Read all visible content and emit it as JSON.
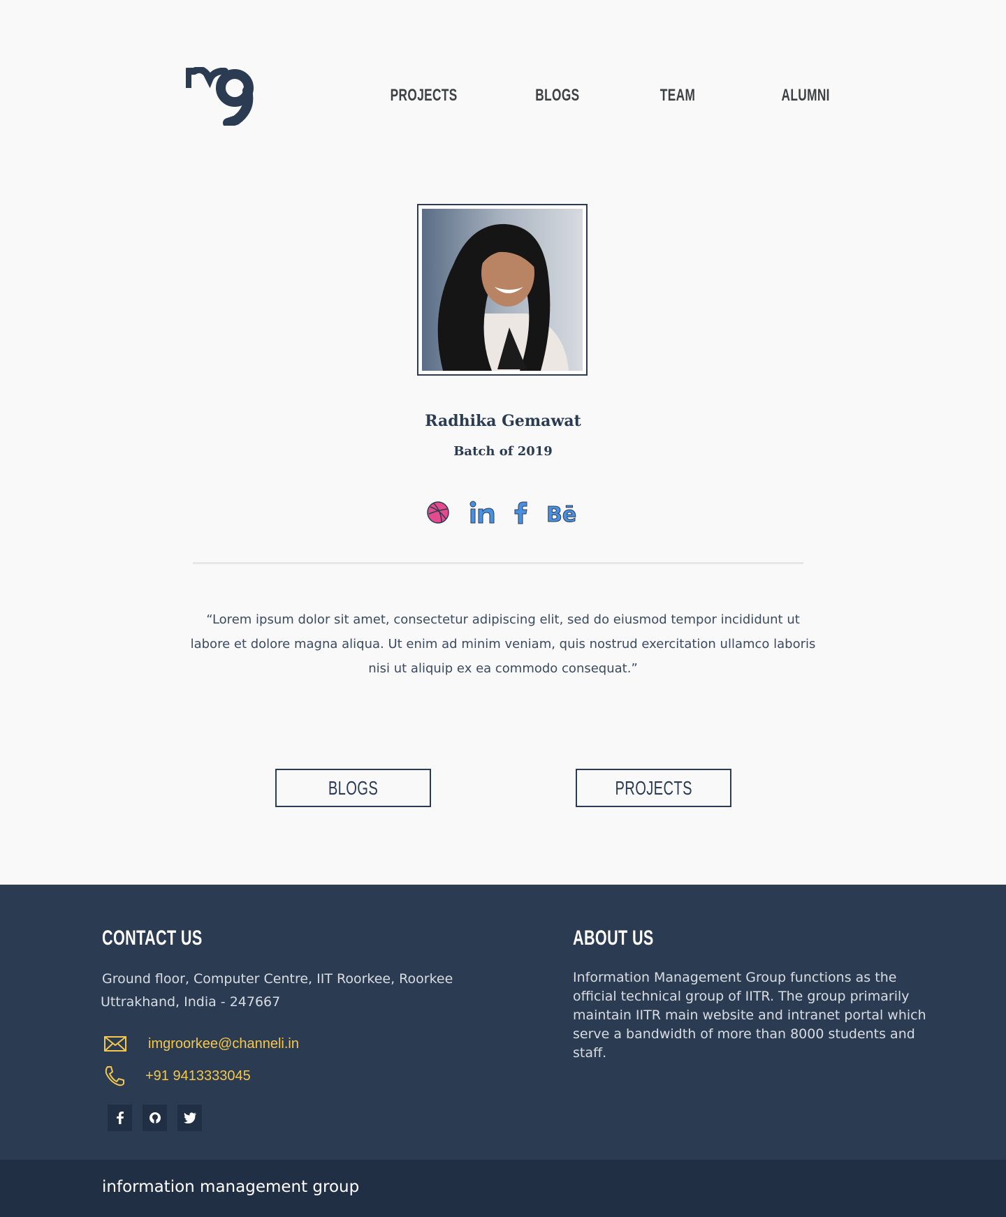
{
  "header": {
    "logo_icon": "img-logo-icon",
    "nav": [
      "PROJECTS",
      "BLOGS",
      "TEAM",
      "ALUMNI"
    ]
  },
  "profile": {
    "name": "Radhika Gemawat",
    "batch": "Batch of 2019",
    "social_icons": [
      "dribbble-icon",
      "linkedin-icon",
      "facebook-icon",
      "behance-icon"
    ],
    "quote": "“Lorem ipsum dolor sit amet, consectetur adipiscing elit, sed do eiusmod tempor incididunt ut labore et dolore magna aliqua. Ut enim ad minim veniam, quis nostrud exercitation ullamco laboris nisi ut aliquip ex ea commodo consequat.”"
  },
  "buttons": {
    "blogs": "BLOGS",
    "projects": "PROJECTS"
  },
  "footer": {
    "contact": {
      "heading": "CONTACT US",
      "address_line1": "Ground floor, Computer Centre, IIT Roorkee, Roorkee",
      "address_line2": "Uttrakhand, India - 247667",
      "email": "imgroorkee@channeli.in",
      "phone": "+91 9413333045"
    },
    "about": {
      "heading": "ABOUT US",
      "text": "Information Management Group functions as the official technical group of IITR. The group primarily maintain IITR main website and intranet portal which serve a bandwidth of more than 8000 students and staff."
    },
    "social_icons": [
      "facebook-icon",
      "github-icon",
      "twitter-icon"
    ],
    "brand": "information management group"
  },
  "colors": {
    "primary": "#2a3b52",
    "footer_bg": "#2a3b52",
    "footer_bottom_bg": "#212f44",
    "accent_yellow": "#f5c84c",
    "page_bg": "#f9f9f9"
  }
}
